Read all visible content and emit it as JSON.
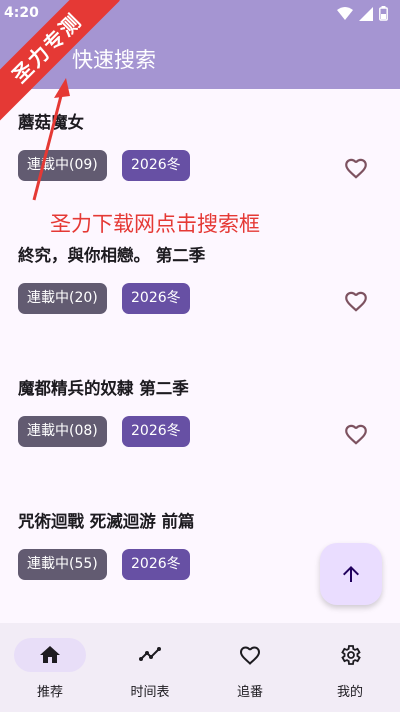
{
  "status_bar": {
    "time": "4:20"
  },
  "app_bar": {
    "title": "快速搜索",
    "back_icon": "arrow-back-icon"
  },
  "items": [
    {
      "title": "蘑菇魔女",
      "status": "連載中(09)",
      "season": "2026冬",
      "favorited": false
    },
    {
      "title": "終究，與你相戀。 第二季",
      "status": "連載中(20)",
      "season": "2026冬",
      "favorited": false
    },
    {
      "title": "魔都精兵的奴隸 第二季",
      "status": "連載中(08)",
      "season": "2026冬",
      "favorited": false
    },
    {
      "title": "咒術迴戰 死滅迴游 前篇",
      "status": "連載中(55)",
      "season": "2026冬",
      "favorited": false
    }
  ],
  "fab": {
    "icon": "arrow-up-icon"
  },
  "bottom_nav": [
    {
      "label": "推荐",
      "icon": "home-icon",
      "active": true
    },
    {
      "label": "时间表",
      "icon": "timeline-icon",
      "active": false
    },
    {
      "label": "追番",
      "icon": "heart-icon",
      "active": false
    },
    {
      "label": "我的",
      "icon": "gear-icon",
      "active": false
    }
  ],
  "overlay": {
    "banner_text": "圣力专测",
    "annotation_text": "圣力下载网点击搜索框"
  },
  "colors": {
    "app_bar": "#a595d2",
    "chip_status": "#625b71",
    "chip_season": "#6750a4",
    "annotation": "#e53935",
    "background": "#fdf7ff"
  }
}
